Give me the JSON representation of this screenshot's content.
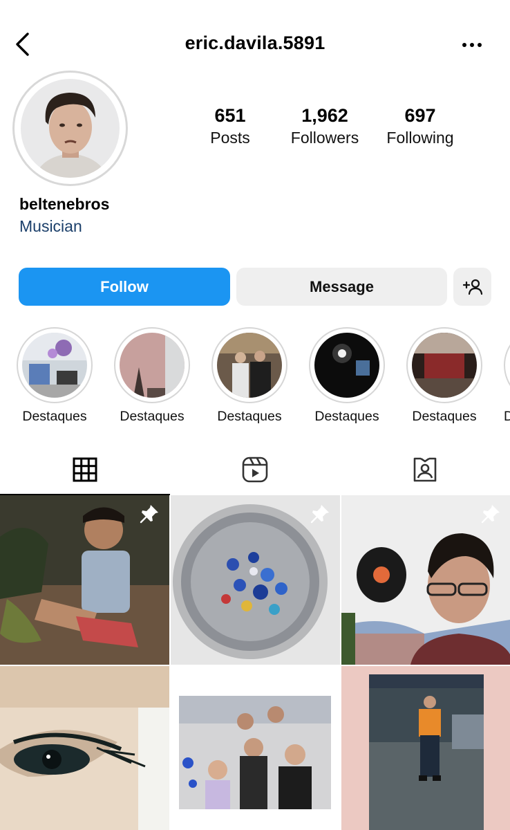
{
  "header": {
    "username": "eric.davila.5891",
    "back_icon": "chevron-left-icon",
    "more_icon": "ellipsis-icon"
  },
  "profile": {
    "display_name": "beltenebros",
    "category": "Musician"
  },
  "stats": [
    {
      "value": "651",
      "label": "Posts"
    },
    {
      "value": "1,962",
      "label": "Followers"
    },
    {
      "value": "697",
      "label": "Following"
    }
  ],
  "actions": {
    "follow": "Follow",
    "message": "Message",
    "add_user_icon": "add-user-icon"
  },
  "highlights": [
    {
      "label": "Destaques"
    },
    {
      "label": "Destaques"
    },
    {
      "label": "Destaques"
    },
    {
      "label": "Destaques"
    },
    {
      "label": "Destaques"
    },
    {
      "label": "D"
    }
  ],
  "tabs": [
    {
      "name": "grid",
      "icon": "grid-icon",
      "active": true
    },
    {
      "name": "reels",
      "icon": "reels-icon",
      "active": false
    },
    {
      "name": "tagged",
      "icon": "tagged-icon",
      "active": false
    }
  ],
  "posts": [
    {
      "pinned": true
    },
    {
      "pinned": true
    },
    {
      "pinned": true
    },
    {
      "pinned": false
    },
    {
      "pinned": false
    },
    {
      "pinned": false
    }
  ],
  "colors": {
    "accent": "#1b95f2",
    "category_text": "#1b3f6a",
    "button_bg": "#efefef"
  }
}
